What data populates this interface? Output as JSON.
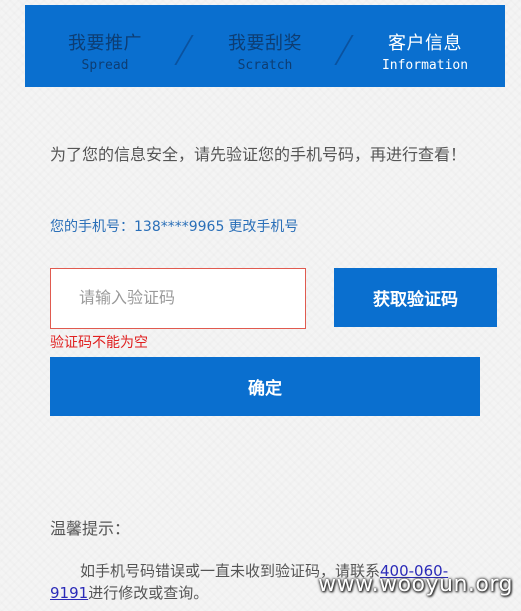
{
  "tabs": [
    {
      "cn": "我要推广",
      "en": "Spread",
      "active": false
    },
    {
      "cn": "我要刮奖",
      "en": "Scratch",
      "active": false
    },
    {
      "cn": "客户信息",
      "en": "Information",
      "active": true
    }
  ],
  "notice": "为了您的信息安全，请先验证您的手机号码，再进行查看！",
  "phone": {
    "label": "您的手机号：",
    "number": "138****9965",
    "change_link": "更改手机号"
  },
  "verify": {
    "input_placeholder": "请输入验证码",
    "input_value": "",
    "get_code_label": "获取验证码",
    "error": "验证码不能为空"
  },
  "confirm_label": "确定",
  "tips": {
    "title": "温馨提示：",
    "body_prefix": "如手机号码错误或一直未收到验证码，请联系",
    "hotline": "400-060-9191",
    "body_suffix": "进行修改或查询。"
  },
  "watermark": "www.wooyun.org",
  "colors": {
    "primary": "#0a6fcf",
    "error": "#e02020",
    "link": "#2a6fb8"
  }
}
